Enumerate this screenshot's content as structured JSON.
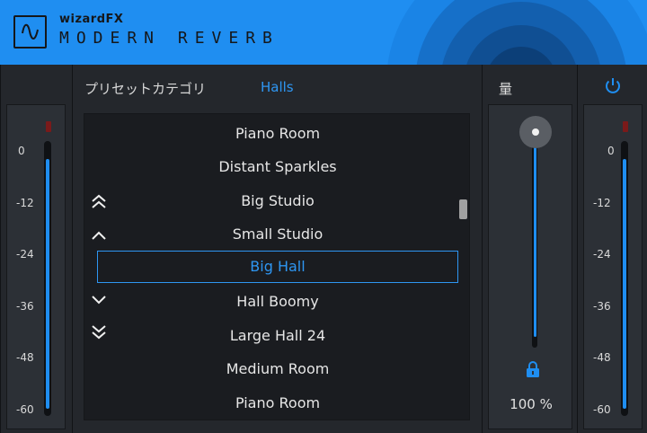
{
  "header": {
    "brand": "wizardFX",
    "product": "MODERN REVERB"
  },
  "meters": {
    "left": {
      "ticks": [
        "0",
        "-12",
        "-24",
        "-36",
        "-48",
        "-60"
      ],
      "level": 0.96
    },
    "right": {
      "ticks": [
        "0",
        "-12",
        "-24",
        "-36",
        "-48",
        "-60"
      ],
      "level": 0.96
    }
  },
  "preset": {
    "category_label": "プリセットカテゴリ",
    "category_value": "Halls",
    "items": [
      "Piano Room",
      "Distant Sparkles",
      "Big Studio",
      "Small Studio",
      "Big Hall",
      "Hall Boomy",
      "Large Hall 24",
      "Medium Room",
      "Piano Room"
    ],
    "selected_index": 4,
    "nav_icons": [
      "double-chevron-up-icon",
      "chevron-up-icon",
      "chevron-down-icon",
      "double-chevron-down-icon"
    ]
  },
  "amount": {
    "label": "量",
    "value": "100 %",
    "level": 1.0,
    "lock_icon": "lock-icon"
  },
  "power": {
    "icon": "power-icon"
  },
  "colors": {
    "accent": "#1f8ef1",
    "selected_text": "#2e96f2",
    "clip_led": "#7a1a1a"
  }
}
